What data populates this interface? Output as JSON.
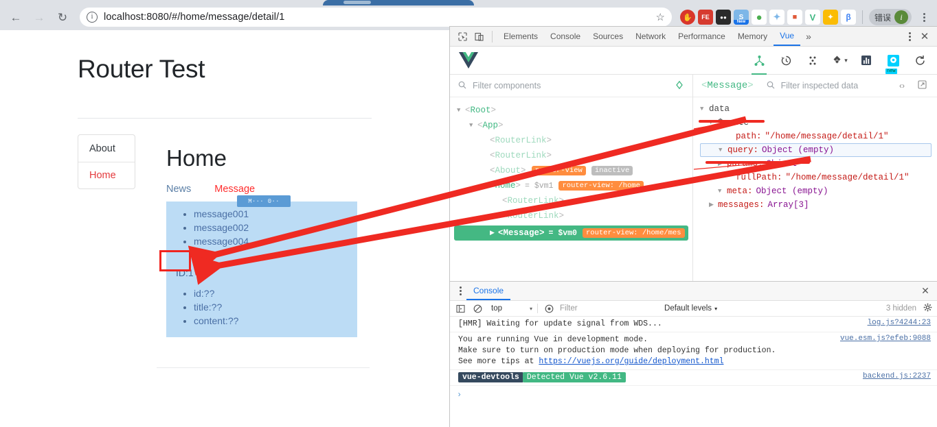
{
  "browser": {
    "back_icon": "back-arrow",
    "forward_icon": "forward-arrow",
    "reload_icon": "reload",
    "site_info_icon": "info-circle",
    "url": "localhost:8080/#/home/message/detail/1",
    "bookmark_icon": "star-outline",
    "extensions": [
      {
        "name": "adblock-extension",
        "glyph": "✋",
        "color": "#d9362b"
      },
      {
        "name": "feedly-extension",
        "glyph": "FE",
        "color": "#d63b2f"
      },
      {
        "name": "tampermonkey-extension",
        "glyph": "●●",
        "color": "#2b2b2b"
      },
      {
        "name": "screenshot-extension",
        "glyph": "S",
        "color": "#5b9bd5",
        "badge": "New"
      },
      {
        "name": "evernote-extension",
        "glyph": "●",
        "color": "#4caf50"
      },
      {
        "name": "bird-extension",
        "glyph": "◆",
        "color": "#7eb7e8"
      },
      {
        "name": "lion-extension",
        "glyph": "■",
        "color": "#e05a3a"
      },
      {
        "name": "vue-devtools-extension",
        "glyph": "V",
        "color": "#42b883"
      },
      {
        "name": "translate-extension",
        "glyph": "✦",
        "color": "#fbbc05"
      },
      {
        "name": "bluetooth-extension",
        "glyph": "β",
        "color": "#4285f4"
      }
    ],
    "profile_label": "错误",
    "profile_avatar": "i",
    "menu_icon": "kebab-menu"
  },
  "page": {
    "title": "Router Test",
    "nav_items": [
      {
        "label": "About",
        "active": false
      },
      {
        "label": "Home",
        "active": true
      }
    ],
    "home": {
      "heading": "Home",
      "tabs": [
        {
          "label": "News",
          "active": false
        },
        {
          "label": "Message",
          "active": true
        }
      ],
      "messages": [
        "message001",
        "message002",
        "message004"
      ],
      "detail_id": "ID:1",
      "detail_fields": [
        "id:??",
        "title:??",
        "content:??"
      ],
      "overlay_badge": "M···    0··"
    }
  },
  "devtools": {
    "tool_icons": [
      "inspect-element-icon",
      "device-toolbar-icon"
    ],
    "tabs": [
      {
        "label": "Elements",
        "selected": false
      },
      {
        "label": "Console",
        "selected": false
      },
      {
        "label": "Sources",
        "selected": false
      },
      {
        "label": "Network",
        "selected": false
      },
      {
        "label": "Performance",
        "selected": false
      },
      {
        "label": "Memory",
        "selected": false
      },
      {
        "label": "Vue",
        "selected": true
      }
    ],
    "more_tabs_icon": "»",
    "settings_icon": "kebab-menu-icon",
    "close_icon": "✕"
  },
  "vue_panel": {
    "logo_icon": "vue-logo",
    "actions": [
      {
        "name": "components-tab-icon",
        "glyph": "⑂",
        "selected": true
      },
      {
        "name": "timeline-tab-icon",
        "glyph": "↺",
        "selected": false
      },
      {
        "name": "vuex-tab-icon",
        "glyph": "⁙",
        "selected": false
      },
      {
        "name": "routing-tab-icon",
        "glyph": "❖",
        "selected": false,
        "chevron": "⌄"
      },
      {
        "name": "performance-tab-icon",
        "glyph": "█",
        "selected": false
      },
      {
        "name": "settings-tab-icon",
        "glyph": "⚙",
        "selected": false,
        "badge": "new"
      },
      {
        "name": "refresh-button-icon",
        "glyph": "↻",
        "selected": false
      }
    ],
    "component_filter_placeholder": "Filter components",
    "select_component_icon": "target-icon",
    "tree": [
      {
        "indent": 0,
        "caret": "▼",
        "tag": "Root",
        "dim": false,
        "vm": "",
        "badge": "",
        "badge_type": "",
        "selected": false
      },
      {
        "indent": 1,
        "caret": "▼",
        "tag": "App",
        "dim": false,
        "vm": "",
        "badge": "",
        "badge_type": "",
        "selected": false
      },
      {
        "indent": 2,
        "caret": "",
        "tag": "RouterLink",
        "dim": true,
        "vm": "",
        "badge": "",
        "badge_type": "",
        "selected": false
      },
      {
        "indent": 2,
        "caret": "",
        "tag": "RouterLink",
        "dim": true,
        "vm": "",
        "badge": "",
        "badge_type": "",
        "selected": false
      },
      {
        "indent": 2,
        "caret": "",
        "tag": "About",
        "dim": true,
        "vm": "",
        "badge": "router-view",
        "badge_type": "router",
        "badge2": "inactive",
        "selected": false
      },
      {
        "indent": 2,
        "caret": "▼",
        "tag": "Home",
        "dim": false,
        "vm": "= $vm1",
        "badge": "router-view: /home",
        "badge_type": "router",
        "selected": false
      },
      {
        "indent": 3,
        "caret": "",
        "tag": "RouterLink",
        "dim": true,
        "vm": "",
        "badge": "",
        "badge_type": "",
        "selected": false
      },
      {
        "indent": 3,
        "caret": "",
        "tag": "RouterLink",
        "dim": true,
        "vm": "",
        "badge": "",
        "badge_type": "",
        "selected": false
      },
      {
        "indent": 3,
        "caret": "▶",
        "tag": "Message",
        "dim": false,
        "vm": "= $vm0",
        "badge": "router-view: /home/mes",
        "badge_type": "router",
        "selected": true
      }
    ],
    "inspector": {
      "component_name": "Message",
      "filter_placeholder": "Filter inspected data",
      "code_icon": "‹›",
      "open-in-editor_icon": "↗",
      "rows": [
        {
          "indent": 0,
          "caret": "▼",
          "key": "data",
          "key_class": "key-plain",
          "value": "",
          "value_class": "",
          "focus": false
        },
        {
          "indent": 1,
          "caret": "▼",
          "key": "$route",
          "key_class": "key-plain",
          "value": "",
          "value_class": "",
          "focus": false
        },
        {
          "indent": 2,
          "caret": "",
          "key": "path:",
          "key_class": "key-prop",
          "value": "\"/home/message/detail/1\"",
          "value_class": "val-str",
          "focus": false
        },
        {
          "indent": 2,
          "caret": "▼",
          "key": "query:",
          "key_class": "key-prop",
          "value": "Object (empty)",
          "value_class": "val-obj",
          "focus": true
        },
        {
          "indent": 2,
          "caret": "▶",
          "key": "params:",
          "key_class": "key-prop",
          "value": "Object",
          "value_class": "val-obj",
          "focus": false
        },
        {
          "indent": 2,
          "caret": "",
          "key": "fullPath:",
          "key_class": "key-prop",
          "value": "\"/home/message/detail/1\"",
          "value_class": "val-str",
          "focus": false
        },
        {
          "indent": 2,
          "caret": "▼",
          "key": "meta:",
          "key_class": "key-prop",
          "value": "Object (empty)",
          "value_class": "val-obj",
          "focus": false
        },
        {
          "indent": 1,
          "caret": "▶",
          "key": "messages:",
          "key_class": "key-prop",
          "value": "Array[3]",
          "value_class": "val-obj",
          "focus": false
        }
      ]
    }
  },
  "console": {
    "drawer_kebab_icon": "kebab-menu-icon",
    "tabs": [
      {
        "label": "Console",
        "selected": true
      }
    ],
    "close_icon": "✕",
    "toolbar": {
      "sidebar_toggle_icon": "show-console-sidebar-icon",
      "clear_icon": "clear-console-icon",
      "context": "top",
      "context_chevron": "▾",
      "eye_icon": "live-expression-icon",
      "filter_placeholder": "Filter",
      "levels_label": "Default levels",
      "levels_chevron": "▾",
      "hidden_label": "3 hidden",
      "settings_icon": "gear-icon"
    },
    "messages": [
      {
        "lines": [
          "[HMR] Waiting for update signal from WDS..."
        ],
        "source": "log.js?4244:23",
        "type": "plain"
      },
      {
        "lines": [
          "You are running Vue in development mode.",
          "Make sure to turn on production mode when deploying for production.",
          "See more tips at https://vuejs.org/guide/deployment.html"
        ],
        "link": "https://vuejs.org/guide/deployment.html",
        "source": "vue.esm.js?efeb:9088",
        "type": "plain"
      },
      {
        "tag_dark": "vue-devtools",
        "tag_green": "Detected Vue v2.6.11",
        "source": "backend.js:2237",
        "type": "tagged"
      }
    ],
    "prompt_glyph": "›"
  },
  "annotations": {
    "highlight_box_color": "#f0241f",
    "arrow_color": "#ef2a22",
    "underline_color": "#ef2a22"
  }
}
